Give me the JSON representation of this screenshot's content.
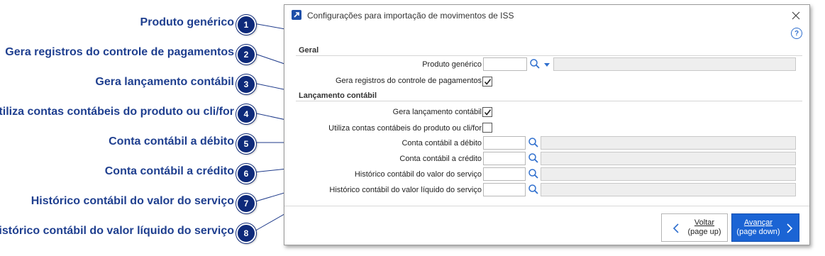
{
  "callouts": [
    {
      "n": "1",
      "label": "Produto genérico"
    },
    {
      "n": "2",
      "label": "Gera registros do controle de pagamentos"
    },
    {
      "n": "3",
      "label": "Gera lançamento contábil"
    },
    {
      "n": "4",
      "label": "Utiliza contas contábeis do produto ou cli/for"
    },
    {
      "n": "5",
      "label": "Conta contábil a débito"
    },
    {
      "n": "6",
      "label": "Conta contábil a crédito"
    },
    {
      "n": "7",
      "label": "Histórico contábil do valor do serviço"
    },
    {
      "n": "8",
      "label": "Histórico contábil do valor líquido do serviço"
    }
  ],
  "dialog": {
    "title": "Configurações para importação de movimentos de ISS",
    "help": "?",
    "sections": {
      "geral": "Geral",
      "lancamento": "Lançamento contábil"
    },
    "fields": {
      "produto_generico": {
        "label": "Produto genérico",
        "value": ""
      },
      "gera_registros": {
        "label": "Gera registros do controle de pagamentos",
        "checked": true
      },
      "gera_lancamento": {
        "label": "Gera lançamento contábil",
        "checked": true
      },
      "utiliza_contas": {
        "label": "Utiliza contas contábeis do produto ou cli/for",
        "checked": false
      },
      "conta_debito": {
        "label": "Conta contábil a débito",
        "value": ""
      },
      "conta_credito": {
        "label": "Conta contábil a crédito",
        "value": ""
      },
      "hist_valor_servico": {
        "label": "Histórico contábil do valor do serviço",
        "value": ""
      },
      "hist_valor_liquido": {
        "label": "Histórico contábil do valor líquido do serviço",
        "value": ""
      }
    },
    "buttons": {
      "back_line1": "Voltar",
      "back_line2": "(page up)",
      "next_line1": "Avançar",
      "next_line2": "(page down)"
    }
  },
  "colors": {
    "callout_text": "#1f3f8f",
    "badge": "#0e2a7a",
    "primary_button": "#1b64d4",
    "search_icon": "#2f6fce"
  },
  "icons": [
    "app-icon",
    "close-icon",
    "help-icon",
    "search-icon",
    "dropdown-arrow-icon",
    "checkmark-icon",
    "chevron-left-icon",
    "chevron-right-icon"
  ]
}
